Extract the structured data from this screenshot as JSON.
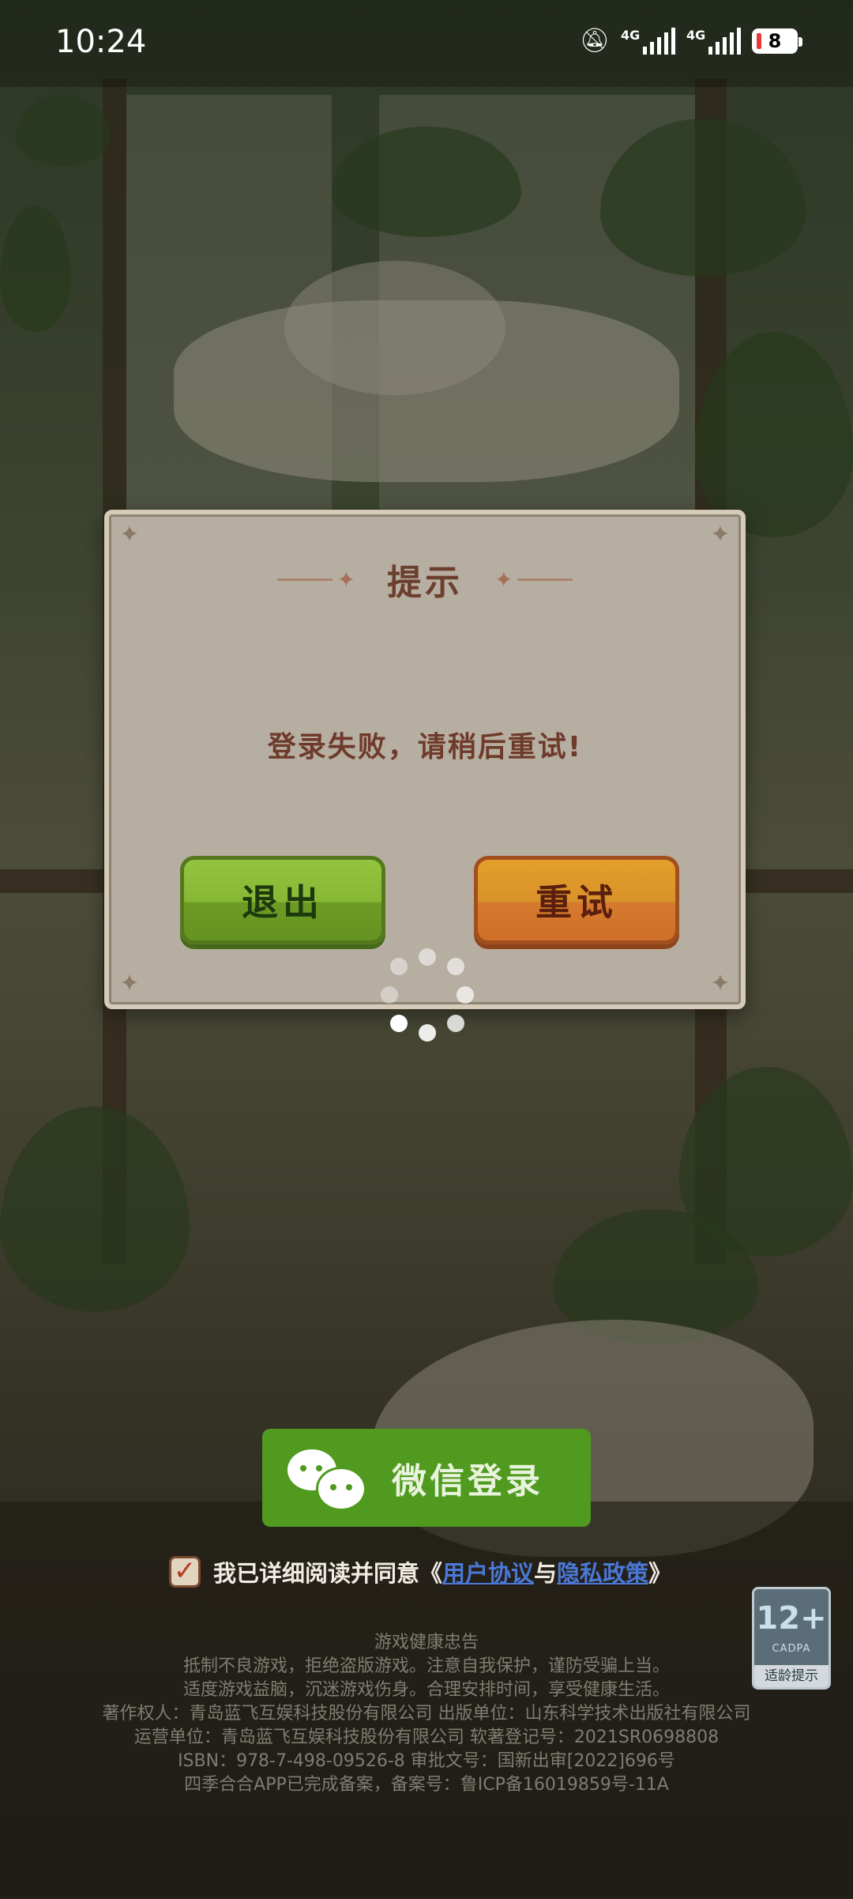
{
  "status_bar": {
    "time": "10:24",
    "signal_1_label": "4G",
    "signal_2_label": "4G",
    "battery": "8",
    "battery_color": "#e53935"
  },
  "dialog": {
    "title": "提示",
    "message": "登录失败，请稍后重试!",
    "exit_button": "退出",
    "retry_button": "重试",
    "exit_color": "#86b836",
    "retry_color": "#d8922a"
  },
  "login": {
    "wechat_button": "微信登录",
    "wechat_color": "#4f9a1f"
  },
  "agreement": {
    "checked": true,
    "prefix": "我已详细阅读并同意《",
    "user_agreement": "用户协议",
    "conjunction": "与",
    "privacy_policy": "隐私政策",
    "suffix": "》",
    "link_color": "#4a78d6"
  },
  "age_rating": {
    "number": "12+",
    "org": "CADPA",
    "label": "适龄提示"
  },
  "footer": {
    "lines": [
      "游戏健康忠告",
      "抵制不良游戏，拒绝盗版游戏。注意自我保护，谨防受骗上当。",
      "适度游戏益脑，沉迷游戏伤身。合理安排时间，享受健康生活。",
      "著作权人：青岛蓝飞互娱科技股份有限公司 出版单位：山东科学技术出版社有限公司",
      "运营单位：青岛蓝飞互娱科技股份有限公司 软著登记号：2021SR0698808",
      "ISBN：978-7-498-09526-8 审批文号：国新出审[2022]696号",
      "四季合合APP已完成备案，备案号：鲁ICP备16019859号-11A"
    ]
  }
}
